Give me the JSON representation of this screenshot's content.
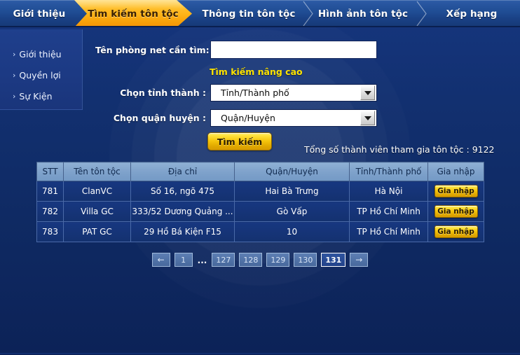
{
  "nav": {
    "tabs": [
      {
        "label": "Giới thiệu",
        "active": false
      },
      {
        "label": "Tìm kiếm tôn tộc",
        "active": true
      },
      {
        "label": "Thông tin tôn tộc",
        "active": false
      },
      {
        "label": "Hình ảnh tôn tộc",
        "active": false
      },
      {
        "label": "Xếp hạng",
        "active": false
      }
    ]
  },
  "sidebar": {
    "items": [
      {
        "label": "Giới thiệu",
        "caret": "›"
      },
      {
        "label": "Quyền lợi",
        "caret": "›"
      },
      {
        "label": "Sự Kiện",
        "caret": "›"
      }
    ]
  },
  "form": {
    "name_label": "Tên phòng net cần tìm:",
    "name_value": "",
    "name_placeholder": "",
    "advanced_search_link": "Tìm kiếm nâng cao",
    "province_label": "Chọn tỉnh thành :",
    "province_value": "Tỉnh/Thành phố",
    "district_label": "Chọn quận huyện :",
    "district_value": "Quận/Huyện",
    "search_button": "Tìm kiếm"
  },
  "summary": {
    "total_text": "Tổng số thành viên tham gia tôn tộc : 9122",
    "total_count": 9122
  },
  "table": {
    "headers": [
      "STT",
      "Tên tôn tộc",
      "Địa chỉ",
      "Quận/Huyện",
      "Tỉnh/Thành phố",
      "Gia nhập"
    ],
    "rows": [
      {
        "stt": "781",
        "name": "ClanVC",
        "address": "Số 16, ngõ 475",
        "district": "Hai Bà Trưng",
        "province": "Hà Nội",
        "action": "Gia nhập"
      },
      {
        "stt": "782",
        "name": "Villa GC",
        "address": "333/52 Dương Quảng ...",
        "district": "Gò Vấp",
        "province": "TP Hồ Chí Minh",
        "action": "Gia nhập"
      },
      {
        "stt": "783",
        "name": "PAT GC",
        "address": "29 Hồ Bá Kiện F15",
        "district": "10",
        "province": "TP Hồ Chí Minh",
        "action": "Gia nhập"
      }
    ]
  },
  "pagination": {
    "prev": "←",
    "next": "→",
    "ellipsis": "...",
    "pages": [
      "1",
      "127",
      "128",
      "129",
      "130",
      "131"
    ],
    "current": "131"
  },
  "colors": {
    "background": "#123070",
    "active_tab": "#fdb216",
    "nav_blue": "#1f4c93",
    "accent_yellow": "#ffe400",
    "gold_button": "#f5c40b",
    "table_header": "#7fa2cb",
    "table_row": "#173780"
  }
}
